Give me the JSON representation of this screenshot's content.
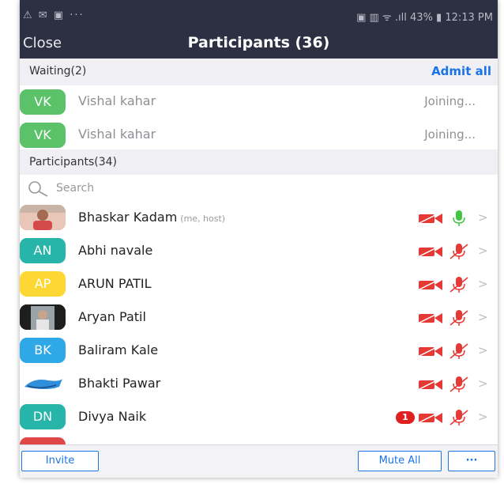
{
  "status_bar": {
    "left_text": "⚠ ✉ ▣ ···",
    "right_text": "▣ ▥ ᯤ .ıll 43% ▮ 12:13 PM"
  },
  "header": {
    "close_label": "Close",
    "title": "Participants (36)"
  },
  "waiting": {
    "label": "Waiting(2)",
    "admit_all_label": "Admit all",
    "items": [
      {
        "initials": "VK",
        "name": "Vishal kahar",
        "status": "Joining..."
      },
      {
        "initials": "VK",
        "name": "Vishal kahar",
        "status": "Joining..."
      }
    ]
  },
  "participants": {
    "label": "Participants(34)",
    "search_placeholder": "Search",
    "items": [
      {
        "initials": "",
        "name": "Bhaskar Kadam",
        "tag": "(me, host)",
        "avatar_color": "#d9a7a0",
        "video": "off",
        "audio": "on"
      },
      {
        "initials": "AN",
        "name": "Abhi navale",
        "tag": "",
        "avatar_color": "#26b5a8",
        "video": "off",
        "audio": "muted"
      },
      {
        "initials": "AP",
        "name": "ARUN PATIL",
        "tag": "",
        "avatar_color": "#fdd835",
        "video": "off",
        "audio": "muted"
      },
      {
        "initials": "",
        "name": "Aryan Patil",
        "tag": "",
        "avatar_color": "#3a3a3a",
        "video": "off",
        "audio": "muted"
      },
      {
        "initials": "BK",
        "name": "Baliram Kale",
        "tag": "",
        "avatar_color": "#2ea8e6",
        "video": "off",
        "audio": "muted"
      },
      {
        "initials": "",
        "name": "Bhakti Pawar",
        "tag": "",
        "avatar_color": "#ffffff",
        "video": "off",
        "audio": "muted"
      },
      {
        "initials": "DN",
        "name": "Divya Naik",
        "tag": "",
        "avatar_color": "#26b5a8",
        "video": "off",
        "audio": "muted",
        "badge": "1"
      }
    ]
  },
  "footer": {
    "invite_label": "Invite",
    "mute_all_label": "Mute All",
    "more_label": "···"
  },
  "colors": {
    "header_bg": "#2d2f42",
    "accent": "#1a74e8",
    "muted_red": "#e53935",
    "mic_on_green": "#43c443",
    "waiting_avatar": "#5cc26a"
  }
}
